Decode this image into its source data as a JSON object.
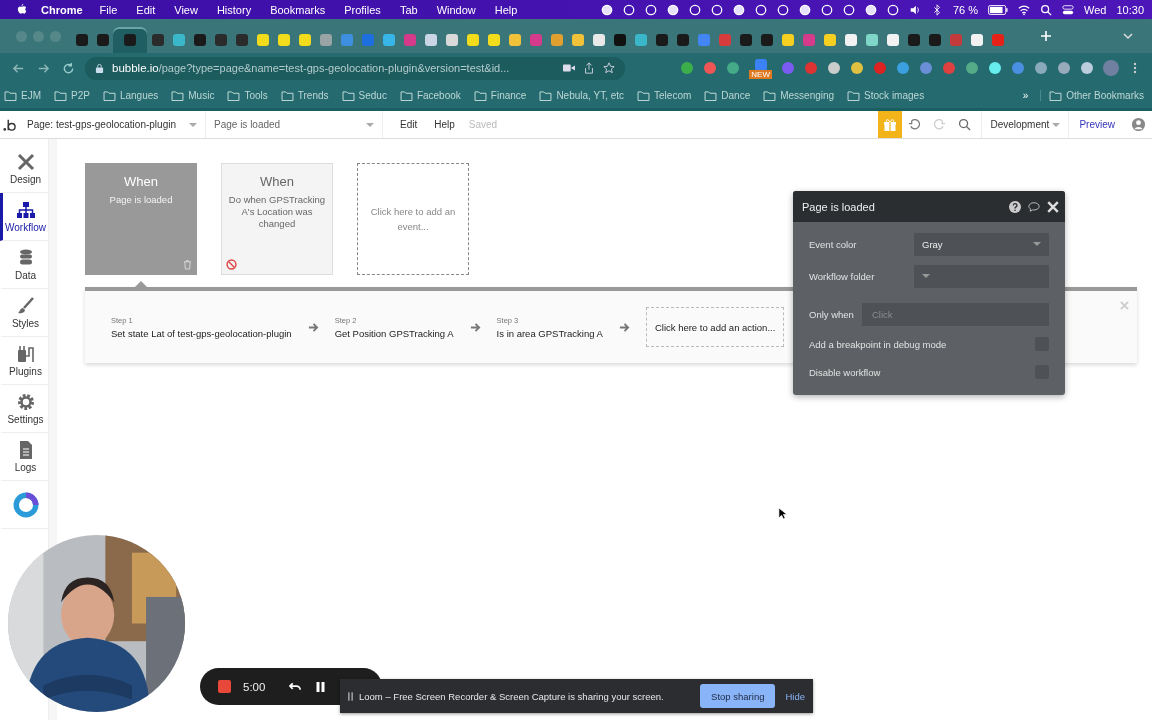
{
  "menubar": {
    "app": "Chrome",
    "menus": [
      "File",
      "Edit",
      "View",
      "History",
      "Bookmarks",
      "Profiles",
      "Tab",
      "Window",
      "Help"
    ],
    "battery": "76 %",
    "day": "Wed",
    "time": "10:30"
  },
  "browser": {
    "tabs": [
      {
        "selected": false,
        "color": "#1a1a1a"
      },
      {
        "selected": false,
        "color": "#1a1a1a"
      },
      {
        "selected": true,
        "color": "#1a1a1a"
      },
      {
        "selected": false,
        "color": "#2b2b2b"
      },
      {
        "selected": false,
        "color": "#3ab7c9"
      },
      {
        "selected": false,
        "color": "#1a1a1a"
      },
      {
        "selected": false,
        "color": "#2b2b2b"
      },
      {
        "selected": false,
        "color": "#2b2b2b"
      },
      {
        "selected": false,
        "color": "#f3dc1c"
      },
      {
        "selected": false,
        "color": "#f3dc1c"
      },
      {
        "selected": false,
        "color": "#f3dc1c"
      },
      {
        "selected": false,
        "color": "#9aa3a6"
      },
      {
        "selected": false,
        "color": "#3f8fe0"
      },
      {
        "selected": false,
        "color": "#1d6fe0"
      },
      {
        "selected": false,
        "color": "#37b5e8"
      },
      {
        "selected": false,
        "color": "#d63a8a"
      },
      {
        "selected": false,
        "color": "#c9d6e6"
      },
      {
        "selected": false,
        "color": "#d9d9d9"
      },
      {
        "selected": false,
        "color": "#f3dc1c"
      },
      {
        "selected": false,
        "color": "#f3dc1c"
      },
      {
        "selected": false,
        "color": "#f0c23a"
      },
      {
        "selected": false,
        "color": "#d63a8a"
      },
      {
        "selected": false,
        "color": "#e0a030"
      },
      {
        "selected": false,
        "color": "#f0c23a"
      },
      {
        "selected": false,
        "color": "#e8e8e8"
      },
      {
        "selected": false,
        "color": "#111111"
      },
      {
        "selected": false,
        "color": "#3ab7c9"
      },
      {
        "selected": false,
        "color": "#1a1a1a"
      },
      {
        "selected": false,
        "color": "#1a1a1a"
      },
      {
        "selected": false,
        "color": "#4285f4"
      },
      {
        "selected": false,
        "color": "#d83b3b"
      },
      {
        "selected": false,
        "color": "#1a1a1a"
      },
      {
        "selected": false,
        "color": "#1a1a1a"
      },
      {
        "selected": false,
        "color": "#f5d020"
      },
      {
        "selected": false,
        "color": "#d63a8a"
      },
      {
        "selected": false,
        "color": "#f5d020"
      },
      {
        "selected": false,
        "color": "#f2f2f2"
      },
      {
        "selected": false,
        "color": "#7fd6c8"
      },
      {
        "selected": false,
        "color": "#f2f2f2"
      },
      {
        "selected": false,
        "color": "#1a1a1a"
      },
      {
        "selected": false,
        "color": "#1a1a1a"
      },
      {
        "selected": false,
        "color": "#c23a3a"
      },
      {
        "selected": false,
        "color": "#f2f2f2"
      },
      {
        "selected": false,
        "color": "#e62117"
      }
    ],
    "url": {
      "host": "bubble.io",
      "path": "/page?type=page&name=test-gps-geolocation-plugin&version=test&id..."
    },
    "extension_badge": "NEW",
    "bookmarks": [
      "EJM",
      "P2P",
      "Langues",
      "Music",
      "Tools",
      "Trends",
      "Seduc",
      "Facebook",
      "Finance",
      "Nebula, YT, etc",
      "Telecom",
      "Dance",
      "Messenging",
      "Stock images"
    ],
    "more": "»",
    "other_bookmarks": "Other Bookmarks"
  },
  "editor": {
    "page_selector": "Page: test-gps-geolocation-plugin",
    "workflow_selector": "Page is loaded",
    "menus": [
      "Edit",
      "Help"
    ],
    "save_status": "Saved",
    "environment": "Development",
    "preview": "Preview"
  },
  "sidebar": {
    "items": [
      {
        "kind": "design",
        "label": "Design",
        "selected": false
      },
      {
        "kind": "workflow",
        "label": "Workflow",
        "selected": true
      },
      {
        "kind": "data",
        "label": "Data",
        "selected": false
      },
      {
        "kind": "styles",
        "label": "Styles",
        "selected": false
      },
      {
        "kind": "plugins",
        "label": "Plugins",
        "selected": false
      },
      {
        "kind": "settings",
        "label": "Settings",
        "selected": false
      },
      {
        "kind": "logs",
        "label": "Logs",
        "selected": false
      },
      {
        "kind": "logo",
        "selected": false
      }
    ]
  },
  "events": [
    {
      "kind": "event",
      "title": "When",
      "text": "Page is loaded",
      "selected": true,
      "disabled": false
    },
    {
      "kind": "event",
      "title": "When",
      "text": "Do when GPSTracking A's Location was changed",
      "selected": false,
      "disabled": true
    },
    {
      "kind": "add",
      "text": "Click here to add an event..."
    }
  ],
  "actions": {
    "steps": [
      {
        "step": "Step 1",
        "text": "Set state Lat of test-gps-geolocation-plugin"
      },
      {
        "step": "Step 2",
        "text": "Get Position GPSTracking A"
      },
      {
        "step": "Step 3",
        "text": "Is in area GPSTracking A"
      }
    ],
    "add": "Click here to add an action..."
  },
  "panel": {
    "title": "Page is loaded",
    "fields": [
      {
        "kind": "select",
        "label": "Event color",
        "value": "Gray"
      },
      {
        "kind": "select",
        "label": "Workflow folder"
      },
      {
        "kind": "text",
        "label": "Only when",
        "placeholder": "Click"
      },
      {
        "kind": "checkbox",
        "label": "Add a breakpoint in debug mode",
        "checked": false
      },
      {
        "kind": "checkbox",
        "label": "Disable workflow",
        "checked": false
      }
    ]
  },
  "loom": {
    "timer": "5:00",
    "banner": "Loom – Free Screen Recorder & Screen Capture is sharing your screen.",
    "stop": "Stop sharing",
    "hide": "Hide"
  }
}
